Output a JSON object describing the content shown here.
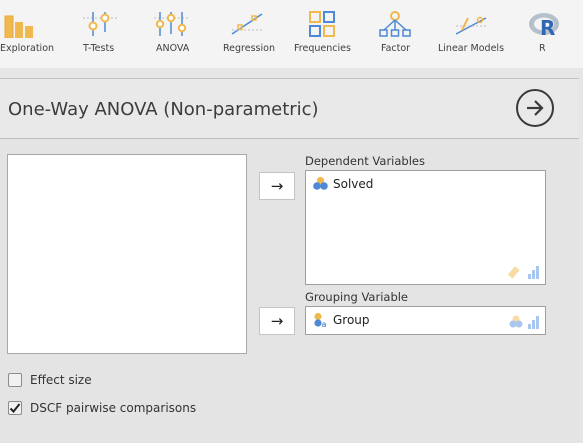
{
  "toolbar": {
    "items": [
      {
        "label": "Exploration",
        "icon": "exploration-icon"
      },
      {
        "label": "T-Tests",
        "icon": "ttests-icon"
      },
      {
        "label": "ANOVA",
        "icon": "anova-icon"
      },
      {
        "label": "Regression",
        "icon": "regression-icon"
      },
      {
        "label": "Frequencies",
        "icon": "frequencies-icon"
      },
      {
        "label": "Factor",
        "icon": "factor-icon"
      },
      {
        "label": "Linear Models",
        "icon": "linear-models-icon"
      },
      {
        "label": "R",
        "icon": "r-icon"
      }
    ]
  },
  "panel": {
    "title": "One-Way ANOVA (Non-parametric)",
    "dependent_label": "Dependent Variables",
    "dependent_items": [
      "Solved"
    ],
    "grouping_label": "Grouping Variable",
    "grouping_value": "Group",
    "options": [
      {
        "label": "Effect size",
        "checked": false
      },
      {
        "label": "DSCF pairwise comparisons",
        "checked": true
      }
    ]
  },
  "colors": {
    "accent": "#f0b94f",
    "blue": "#4e89d6"
  }
}
